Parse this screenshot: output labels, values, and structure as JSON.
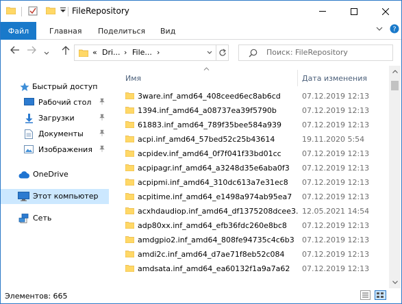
{
  "window": {
    "title": "FileRepository",
    "controls": {
      "minimize": "—",
      "maximize": "☐",
      "close": "✕"
    }
  },
  "ribbon": {
    "tabs": [
      {
        "label": "Файл",
        "active": true
      },
      {
        "label": "Главная"
      },
      {
        "label": "Поделиться"
      },
      {
        "label": "Вид"
      }
    ],
    "collapse_icon": "chevron-down",
    "help_icon": "?"
  },
  "navigation": {
    "back": "←",
    "forward": "→",
    "recent": "⌄",
    "up": "↑",
    "breadcrumb": [
      "«",
      "Dri...",
      "›",
      "File...",
      "›"
    ],
    "address_dropdown": "⌄",
    "refresh": "↻",
    "search_placeholder": "Поиск: FileRepository"
  },
  "sidebar": {
    "items": [
      {
        "label": "Быстрый доступ",
        "icon": "star-icon",
        "pinned": false
      },
      {
        "label": "Рабочий стол",
        "icon": "desktop-icon",
        "pinned": true
      },
      {
        "label": "Загрузки",
        "icon": "download-icon",
        "pinned": true
      },
      {
        "label": "Документы",
        "icon": "documents-icon",
        "pinned": true
      },
      {
        "label": "Изображения",
        "icon": "pictures-icon",
        "pinned": true
      },
      {
        "label": "OneDrive",
        "icon": "cloud-icon",
        "pinned": false
      },
      {
        "label": "Этот компьютер",
        "icon": "computer-icon",
        "pinned": false,
        "selected": true
      },
      {
        "label": "Сеть",
        "icon": "network-icon",
        "pinned": false
      }
    ],
    "pin_glyph": "📌"
  },
  "filelist": {
    "columns": {
      "name": "Имя",
      "date": "Дата изменения"
    },
    "sort_glyph": "^",
    "rows": [
      {
        "name": "3ware.inf_amd64_408ceed6ec8ab6cd",
        "date": "07.12.2019 12:13"
      },
      {
        "name": "1394.inf_amd64_a08737ea39f5790b",
        "date": "07.12.2019 12:13"
      },
      {
        "name": "61883.inf_amd64_789f35bee584a939",
        "date": "07.12.2019 12:13"
      },
      {
        "name": "acpi.inf_amd64_57bed52c25b43614",
        "date": "19.11.2020 5:54"
      },
      {
        "name": "acpidev.inf_amd64_0f7f041f33bd01cc",
        "date": "07.12.2019 12:13"
      },
      {
        "name": "acpipagr.inf_amd64_a3248d35e6aba0f3",
        "date": "07.12.2019 12:13"
      },
      {
        "name": "acpipmi.inf_amd64_310dc613a7e31ec8",
        "date": "07.12.2019 12:13"
      },
      {
        "name": "acpitime.inf_amd64_e1498a974ab95ea7",
        "date": "07.12.2019 12:13"
      },
      {
        "name": "acxhdaudiop.inf_amd64_df1375208dcee3...",
        "date": "12.05.2021 14:54"
      },
      {
        "name": "adp80xx.inf_amd64_efb36fdc260e8bc8",
        "date": "07.12.2019 12:13"
      },
      {
        "name": "amdgpio2.inf_amd64_808fe94735c4c6b3",
        "date": "07.12.2019 12:13"
      },
      {
        "name": "amdi2c.inf_amd64_d7ae71f8eb52c084",
        "date": "07.12.2019 12:13"
      },
      {
        "name": "amdsata.inf_amd64_ea60132f1a9a7a62",
        "date": "07.12.2019 12:13"
      }
    ]
  },
  "statusbar": {
    "text": "Элементов: 665"
  },
  "colors": {
    "accent": "#1979ca",
    "selected_bg": "#cce8ff",
    "folder": "#ffd867",
    "folder_dark": "#e8b33b"
  }
}
